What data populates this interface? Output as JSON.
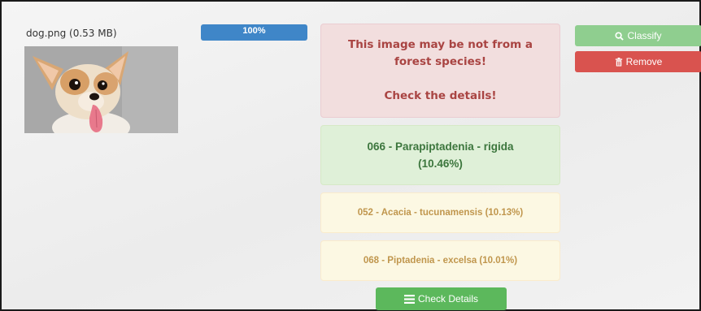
{
  "file": {
    "name": "dog.png (0.53 MB)",
    "upload_progress": 100,
    "progress_label": "100%"
  },
  "alerts": {
    "danger": {
      "line1": "This image may be not from a",
      "line2": "forest species!",
      "line3": "Check the details!"
    },
    "top_result": {
      "line1": "066 - Parapiptadenia - rigida",
      "line2": "(10.46%)"
    },
    "other_results": [
      "052 - Acacia - tucunamensis (10.13%)",
      "068 - Piptadenia - excelsa (10.01%)"
    ]
  },
  "buttons": {
    "classify": "Classify",
    "remove": "Remove",
    "check_details": "Check Details"
  },
  "colors": {
    "progress": "#3f86c8",
    "danger_bg": "#f2dede",
    "danger_text": "#a94442",
    "success_bg": "#dff0d8",
    "success_text": "#3c763d",
    "warning_bg": "#fcf8e3",
    "warning_text": "#c0964d",
    "classify": "#8fce8f",
    "remove": "#d9534f",
    "check_details": "#5cb85c"
  },
  "icons": {
    "classify": "search-icon",
    "remove": "trash-icon",
    "check_details": "list-icon"
  }
}
